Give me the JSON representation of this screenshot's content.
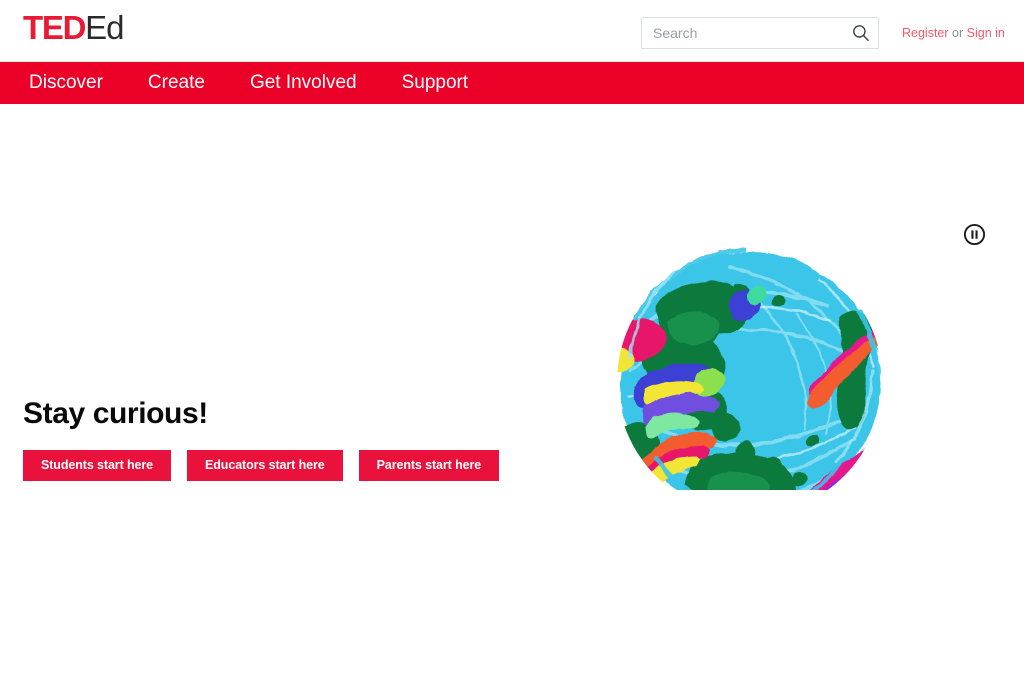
{
  "site": {
    "brand_primary": "TED",
    "brand_secondary": "Ed",
    "colors": {
      "nav_red": "#eb0028",
      "button_red": "#e8123c",
      "logo_red": "#e81b35",
      "link_salmon": "#f4596c",
      "ocean_cyan": "#3bc5e8",
      "land_green": "#0f7a3d"
    }
  },
  "header": {
    "search": {
      "placeholder": "Search",
      "value": "",
      "icon": "search-icon"
    },
    "account": {
      "register_label": "Register",
      "separator": "or",
      "signin_label": "Sign in"
    }
  },
  "nav": {
    "items": [
      {
        "label": "Discover"
      },
      {
        "label": "Create"
      },
      {
        "label": "Get Involved"
      },
      {
        "label": "Support"
      }
    ]
  },
  "hero": {
    "title": "Stay curious!",
    "media_control": {
      "icon": "pause-icon",
      "state": "playing",
      "label": "Pause"
    },
    "ctas": [
      {
        "label": "Students start here"
      },
      {
        "label": "Educators start here"
      },
      {
        "label": "Parents start here"
      }
    ],
    "illustration": {
      "name": "painted-globe",
      "description": "Hand-painted globe with cyan ocean, dark green continents and multicolored brushstroke accents"
    }
  }
}
